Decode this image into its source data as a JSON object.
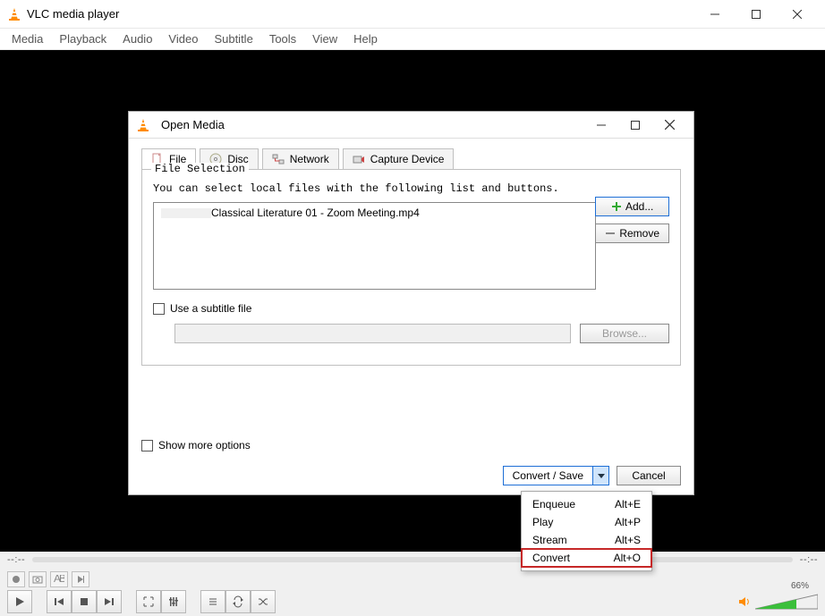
{
  "app": {
    "title": "VLC media player"
  },
  "menu": [
    "Media",
    "Playback",
    "Audio",
    "Video",
    "Subtitle",
    "Tools",
    "View",
    "Help"
  ],
  "seek": {
    "left": "--:--",
    "right": "--:--"
  },
  "volume": {
    "pct": "66%"
  },
  "dialog": {
    "title": "Open Media",
    "tabs": [
      {
        "label": "File",
        "icon": "file"
      },
      {
        "label": "Disc",
        "icon": "disc"
      },
      {
        "label": "Network",
        "icon": "network"
      },
      {
        "label": "Capture Device",
        "icon": "capture"
      }
    ],
    "file_selection": {
      "legend": "File Selection",
      "hint": "You can select local files with the following list and buttons.",
      "items": [
        "Classical Literature 01 - Zoom Meeting.mp4"
      ],
      "add": "Add...",
      "remove": "Remove"
    },
    "subtitle": {
      "checkbox_label": "Use a subtitle file",
      "browse": "Browse..."
    },
    "more_options": "Show more options",
    "convert": "Convert / Save",
    "cancel": "Cancel"
  },
  "dropdown": [
    {
      "label": "Enqueue",
      "shortcut": "Alt+E"
    },
    {
      "label": "Play",
      "shortcut": "Alt+P"
    },
    {
      "label": "Stream",
      "shortcut": "Alt+S"
    },
    {
      "label": "Convert",
      "shortcut": "Alt+O",
      "highlight": true
    }
  ]
}
